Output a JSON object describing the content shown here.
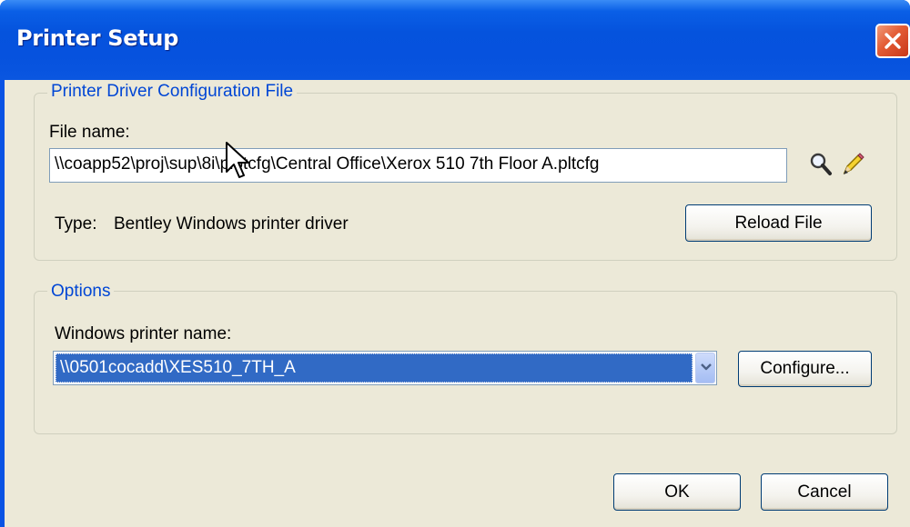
{
  "window": {
    "title": "Printer Setup"
  },
  "driver_group": {
    "title": "Printer Driver Configuration File",
    "file_name_label": "File name:",
    "file_name_value": "\\\\coapp52\\proj\\sup\\8i\\plotcfg\\Central Office\\Xerox 510 7th Floor A.pltcfg",
    "type_label": "Type:",
    "type_value": "Bentley Windows printer driver",
    "reload_button": "Reload File"
  },
  "options_group": {
    "title": "Options",
    "printer_name_label": "Windows printer name:",
    "printer_name_value": "\\\\0501cocadd\\XES510_7TH_A",
    "configure_button": "Configure..."
  },
  "footer": {
    "ok_button": "OK",
    "cancel_button": "Cancel"
  },
  "icons": {
    "browse": "magnifier-icon",
    "edit": "pencil-icon",
    "close": "close-icon",
    "dropdown": "chevron-down-icon"
  },
  "colors": {
    "titlebar": "#0553dd",
    "face": "#ece9d8",
    "group_title": "#0046d5",
    "selection": "#316ac5",
    "close_button": "#e35b34"
  }
}
